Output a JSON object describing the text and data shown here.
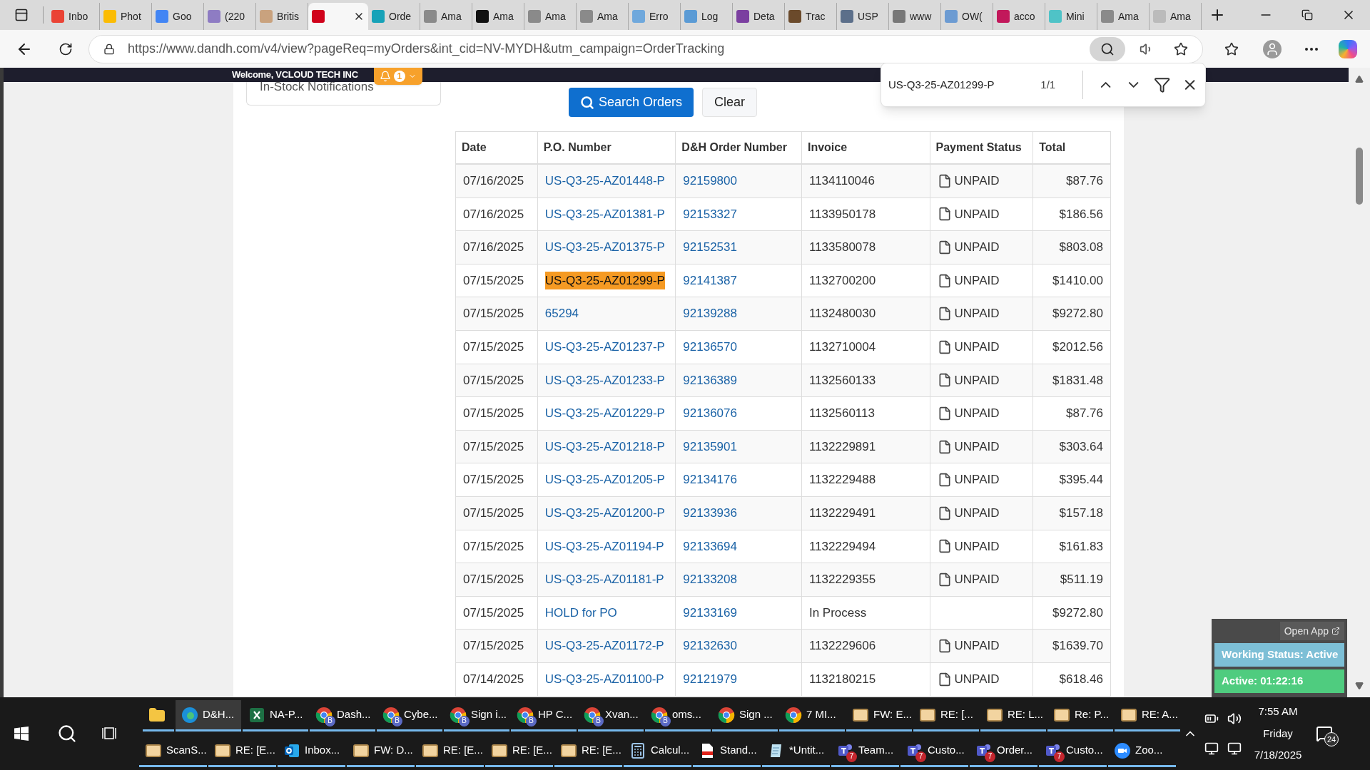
{
  "browser": {
    "tabs": [
      {
        "label": "Inbo",
        "selected": false,
        "color": "#ea4335"
      },
      {
        "label": "Phot",
        "selected": false,
        "color": "#fbbc04"
      },
      {
        "label": "Goo",
        "selected": false,
        "color": "#4285f4"
      },
      {
        "label": "(220",
        "selected": false,
        "color": "#8e7cc3"
      },
      {
        "label": "Britis",
        "selected": false,
        "color": "#c9a27e"
      },
      {
        "selected": true,
        "color": "#d0021b"
      },
      {
        "label": "Orde",
        "selected": false,
        "color": "#17a2b8"
      },
      {
        "label": "Ama",
        "selected": false,
        "color": "#8a8a8a"
      },
      {
        "label": "Ama",
        "selected": false,
        "color": "#111111"
      },
      {
        "label": "Ama",
        "selected": false,
        "color": "#8a8a8a"
      },
      {
        "label": "Ama",
        "selected": false,
        "color": "#8a8a8a"
      },
      {
        "label": "Erro",
        "selected": false,
        "color": "#6fa8dc"
      },
      {
        "label": "Log",
        "selected": false,
        "color": "#5b9bd5"
      },
      {
        "label": "Deta",
        "selected": false,
        "color": "#7b3fa0"
      },
      {
        "label": "Trac",
        "selected": false,
        "color": "#6b4a2b"
      },
      {
        "label": "USP",
        "selected": false,
        "color": "#5c6f8a"
      },
      {
        "label": "www",
        "selected": false,
        "color": "#777777"
      },
      {
        "label": "OW(",
        "selected": false,
        "color": "#6c9bd2"
      },
      {
        "label": "acco",
        "selected": false,
        "color": "#c2185b"
      },
      {
        "label": "Mini",
        "selected": false,
        "color": "#4fc3c7"
      },
      {
        "label": "Ama",
        "selected": false,
        "color": "#8a8a8a"
      },
      {
        "label": "Ama",
        "selected": false,
        "color": "#bbbbbb"
      }
    ],
    "url": "https://www.dandh.com/v4/view?pageReq=myOrders&int_cid=NV-MYDH&utm_campaign=OrderTracking"
  },
  "find_bar": {
    "value": "US-Q3-25-AZ01299-P",
    "count": "1/1"
  },
  "header": {
    "welcome": "Welcome, VCLOUD TECH INC",
    "notification_count": "1"
  },
  "sidebar": {
    "item": "In-Stock Notifications"
  },
  "search": {
    "search_button": "Search Orders",
    "clear_button": "Clear"
  },
  "table": {
    "columns": [
      "Date",
      "P.O. Number",
      "D&H Order Number",
      "Invoice",
      "Payment Status",
      "Total"
    ],
    "rows": [
      {
        "date": "07/16/2025",
        "po": "US-Q3-25-AZ01448-P",
        "order": "92159800",
        "invoice": "1134110046",
        "status": "UNPAID",
        "total": "$87.76",
        "highlighted": false
      },
      {
        "date": "07/16/2025",
        "po": "US-Q3-25-AZ01381-P",
        "order": "92153327",
        "invoice": "1133950178",
        "status": "UNPAID",
        "total": "$186.56",
        "highlighted": false
      },
      {
        "date": "07/16/2025",
        "po": "US-Q3-25-AZ01375-P",
        "order": "92152531",
        "invoice": "1133580078",
        "status": "UNPAID",
        "total": "$803.08",
        "highlighted": false
      },
      {
        "date": "07/15/2025",
        "po": "US-Q3-25-AZ01299-P",
        "order": "92141387",
        "invoice": "1132700200",
        "status": "UNPAID",
        "total": "$1410.00",
        "highlighted": true
      },
      {
        "date": "07/15/2025",
        "po": "65294",
        "order": "92139288",
        "invoice": "1132480030",
        "status": "UNPAID",
        "total": "$9272.80",
        "highlighted": false
      },
      {
        "date": "07/15/2025",
        "po": "US-Q3-25-AZ01237-P",
        "order": "92136570",
        "invoice": "1132710004",
        "status": "UNPAID",
        "total": "$2012.56",
        "highlighted": false
      },
      {
        "date": "07/15/2025",
        "po": "US-Q3-25-AZ01233-P",
        "order": "92136389",
        "invoice": "1132560133",
        "status": "UNPAID",
        "total": "$1831.48",
        "highlighted": false
      },
      {
        "date": "07/15/2025",
        "po": "US-Q3-25-AZ01229-P",
        "order": "92136076",
        "invoice": "1132560113",
        "status": "UNPAID",
        "total": "$87.76",
        "highlighted": false
      },
      {
        "date": "07/15/2025",
        "po": "US-Q3-25-AZ01218-P",
        "order": "92135901",
        "invoice": "1132229891",
        "status": "UNPAID",
        "total": "$303.64",
        "highlighted": false
      },
      {
        "date": "07/15/2025",
        "po": "US-Q3-25-AZ01205-P",
        "order": "92134176",
        "invoice": "1132229488",
        "status": "UNPAID",
        "total": "$395.44",
        "highlighted": false
      },
      {
        "date": "07/15/2025",
        "po": "US-Q3-25-AZ01200-P",
        "order": "92133936",
        "invoice": "1132229491",
        "status": "UNPAID",
        "total": "$157.18",
        "highlighted": false
      },
      {
        "date": "07/15/2025",
        "po": "US-Q3-25-AZ01194-P",
        "order": "92133694",
        "invoice": "1132229494",
        "status": "UNPAID",
        "total": "$161.83",
        "highlighted": false
      },
      {
        "date": "07/15/2025",
        "po": "US-Q3-25-AZ01181-P",
        "order": "92133208",
        "invoice": "1132229355",
        "status": "UNPAID",
        "total": "$511.19",
        "highlighted": false
      },
      {
        "date": "07/15/2025",
        "po": "HOLD for PO",
        "order": "92133169",
        "invoice": "In Process",
        "total": "$9272.80",
        "highlighted": false
      },
      {
        "date": "07/15/2025",
        "po": "US-Q3-25-AZ01172-P",
        "order": "92132630",
        "invoice": "1132229606",
        "status": "UNPAID",
        "total": "$1639.70",
        "highlighted": false
      },
      {
        "date": "07/14/2025",
        "po": "US-Q3-25-AZ01100-P",
        "order": "92121979",
        "invoice": "1132180215",
        "status": "UNPAID",
        "total": "$618.46",
        "highlighted": false
      }
    ]
  },
  "status_widget": {
    "open_app": "Open App",
    "working_status": "Working Status: Active",
    "timer": "Active: 01:22:16"
  },
  "taskbar": {
    "row_1": [
      {
        "kind": "folder",
        "selected": false
      },
      {
        "kind": "edge",
        "label": "D&H...",
        "selected": true
      },
      {
        "kind": "excel",
        "label": "NA-P...",
        "selected": false
      },
      {
        "kind": "chrome",
        "label": "Dash...",
        "badge": "B",
        "selected": false
      },
      {
        "kind": "chrome",
        "label": "Cybe...",
        "badge": "B",
        "selected": false
      },
      {
        "kind": "chrome",
        "label": "Sign i...",
        "badge": "B",
        "selected": false
      },
      {
        "kind": "chrome",
        "label": "HP C...",
        "badge": "B",
        "selected": false
      },
      {
        "kind": "chrome",
        "label": "Xvan...",
        "badge": "B",
        "selected": false
      },
      {
        "kind": "chrome",
        "label": "oms...",
        "badge": "B",
        "selected": false
      },
      {
        "kind": "chrome",
        "label": "Sign ...",
        "selected": false
      },
      {
        "kind": "chrome",
        "label": "7 MI...",
        "selected": false
      },
      {
        "kind": "mail",
        "label": "FW: E...",
        "selected": false
      },
      {
        "kind": "mail",
        "label": "RE: [...",
        "selected": false
      },
      {
        "kind": "mail",
        "label": "RE: L...",
        "selected": false
      },
      {
        "kind": "mail",
        "label": "Re: P...",
        "selected": false
      },
      {
        "kind": "mail",
        "label": "RE: A...",
        "selected": false
      }
    ],
    "row_2": [
      {
        "kind": "mail",
        "label": "ScanS...",
        "selected": false
      },
      {
        "kind": "mail",
        "label": "RE: [E...",
        "selected": false
      },
      {
        "kind": "outlook",
        "label": "Inbox...",
        "selected": false
      },
      {
        "kind": "mail",
        "label": "FW: D...",
        "selected": false
      },
      {
        "kind": "mail",
        "label": "RE: [E...",
        "selected": false
      },
      {
        "kind": "mail",
        "label": "RE: [E...",
        "selected": false
      },
      {
        "kind": "mail",
        "label": "RE: [E...",
        "selected": false
      },
      {
        "kind": "calculator",
        "label": "Calcul...",
        "selected": false
      },
      {
        "kind": "pdf",
        "label": "Stand...",
        "selected": false
      },
      {
        "kind": "notepad",
        "label": "*Untit...",
        "selected": false
      },
      {
        "kind": "teams",
        "label": "Team...",
        "badge": "7",
        "selected": false
      },
      {
        "kind": "teams",
        "label": "Custo...",
        "badge": "7",
        "selected": false
      },
      {
        "kind": "teams",
        "label": "Order...",
        "badge": "7",
        "selected": false
      },
      {
        "kind": "teams",
        "label": "Custo...",
        "badge": "7",
        "selected": false
      },
      {
        "kind": "zoom",
        "label": "Zoo...",
        "selected": false
      }
    ],
    "clock": {
      "time": "7:55 AM",
      "day": "Friday",
      "date": "7/18/2025"
    },
    "notifications": "24"
  }
}
